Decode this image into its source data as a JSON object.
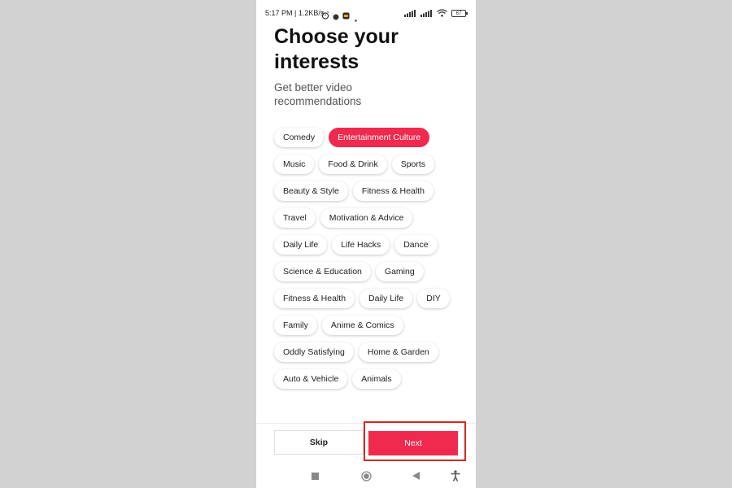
{
  "status_bar": {
    "text": "5:17 PM | 1.2KB/s",
    "battery": "67",
    "icons": [
      "alarm-icon",
      "circle-notification-icon",
      "app-notification-icon",
      "dot-icon",
      "signal-icon",
      "signal-icon",
      "wifi-icon",
      "battery-icon"
    ]
  },
  "header": {
    "title": "Choose your interests",
    "subtitle": "Get better video recommendations"
  },
  "chips": [
    [
      {
        "label": "Comedy",
        "selected": false
      },
      {
        "label": "Entertainment Culture",
        "selected": true
      }
    ],
    [
      {
        "label": "Music",
        "selected": false
      },
      {
        "label": "Food & Drink",
        "selected": false
      },
      {
        "label": "Sports",
        "selected": false
      }
    ],
    [
      {
        "label": "Beauty & Style",
        "selected": false
      },
      {
        "label": "Fitness & Health",
        "selected": false
      }
    ],
    [
      {
        "label": "Travel",
        "selected": false
      },
      {
        "label": "Motivation & Advice",
        "selected": false
      }
    ],
    [
      {
        "label": "Daily Life",
        "selected": false
      },
      {
        "label": "Life Hacks",
        "selected": false
      },
      {
        "label": "Dance",
        "selected": false
      }
    ],
    [
      {
        "label": "Science & Education",
        "selected": false
      },
      {
        "label": "Gaming",
        "selected": false
      }
    ],
    [
      {
        "label": "Fitness & Health",
        "selected": false
      },
      {
        "label": "Daily Life",
        "selected": false
      },
      {
        "label": "DIY",
        "selected": false
      }
    ],
    [
      {
        "label": "Family",
        "selected": false
      },
      {
        "label": "Anime & Comics",
        "selected": false
      }
    ],
    [
      {
        "label": "Oddly Satisfying",
        "selected": false
      },
      {
        "label": "Home & Garden",
        "selected": false
      }
    ],
    [
      {
        "label": "Auto & Vehicle",
        "selected": false
      },
      {
        "label": "Animals",
        "selected": false
      }
    ]
  ],
  "footer": {
    "skip_label": "Skip",
    "next_label": "Next"
  },
  "nav": [
    "recent-apps-icon",
    "home-icon",
    "back-icon",
    "accessibility-icon"
  ],
  "colors": {
    "accent": "#f0294f",
    "highlight_box": "#d32a20",
    "page_bg": "#d2d2d2"
  }
}
